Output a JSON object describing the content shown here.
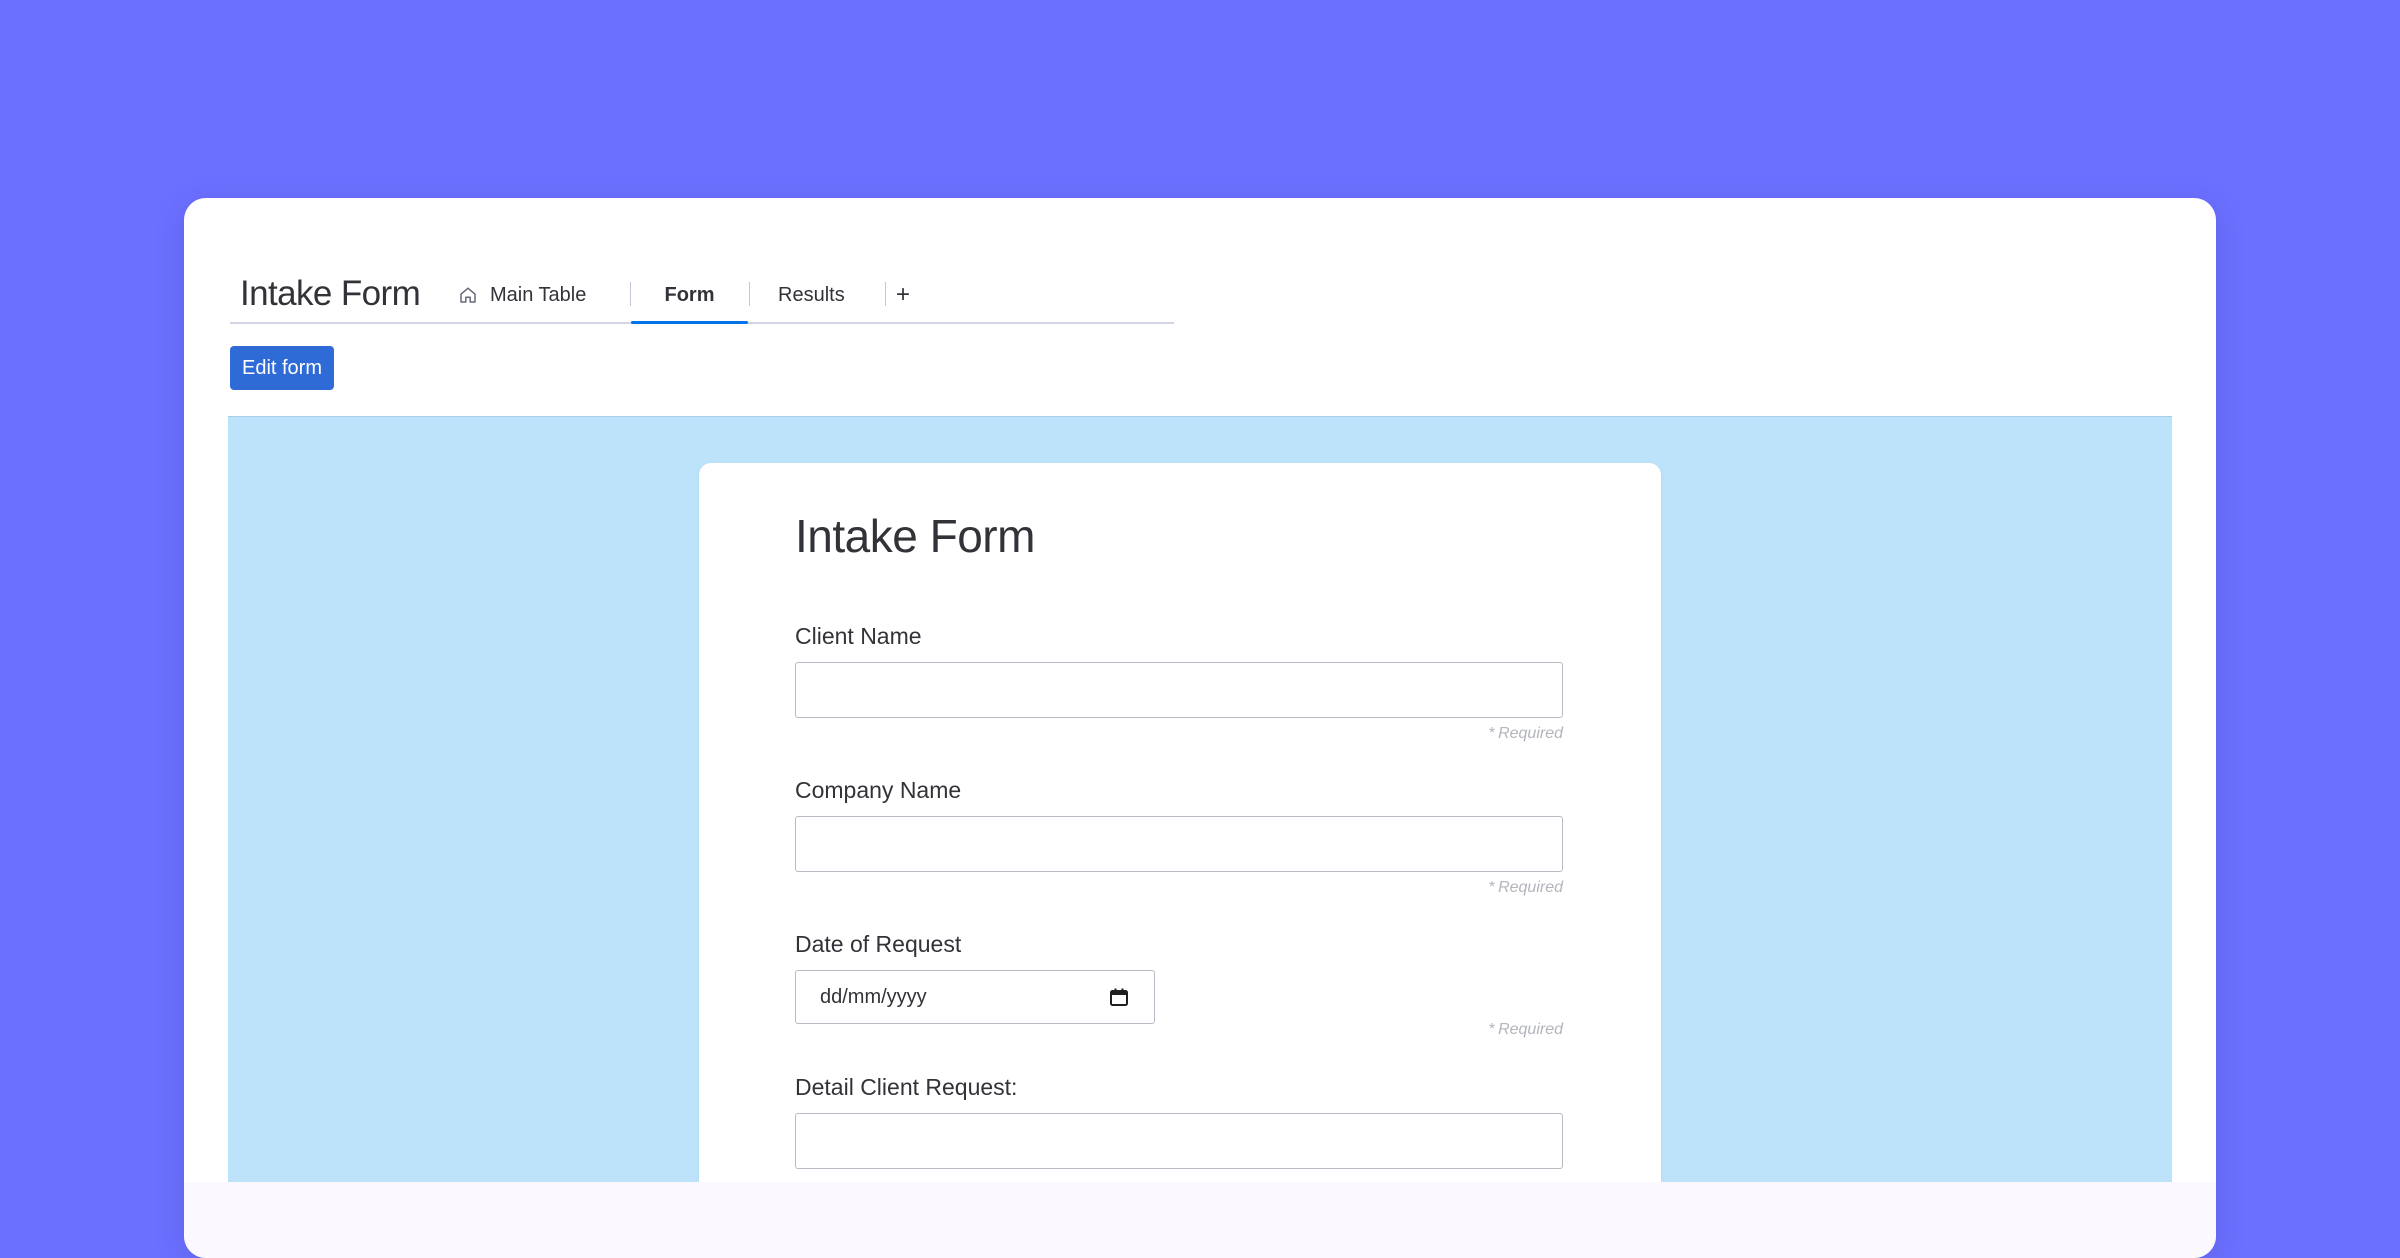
{
  "board": {
    "title": "Intake Form",
    "tabs": [
      {
        "label": "Main Table",
        "icon": "home-icon"
      },
      {
        "label": "Form"
      },
      {
        "label": "Results"
      }
    ],
    "add_tab_label": "+",
    "active_tab": "Form",
    "accent_color": "#0073ea"
  },
  "toolbar": {
    "edit_form_label": "Edit form",
    "button_color": "#2f6bd6"
  },
  "form": {
    "title": "Intake Form",
    "background_color": "#bde3fa",
    "fields": [
      {
        "label": "Client Name",
        "type": "text",
        "value": "",
        "required_text": "Required"
      },
      {
        "label": "Company Name",
        "type": "text",
        "value": "",
        "required_text": "Required"
      },
      {
        "label": "Date of Request",
        "type": "date",
        "placeholder": "dd/mm/yyyy",
        "icon": "calendar-icon",
        "required_text": "Required"
      },
      {
        "label": "Detail Client Request:",
        "type": "text",
        "value": ""
      }
    ],
    "required_marker": "*"
  },
  "colors": {
    "page_background": "#6c70ff",
    "window_background": "#ffffff"
  }
}
